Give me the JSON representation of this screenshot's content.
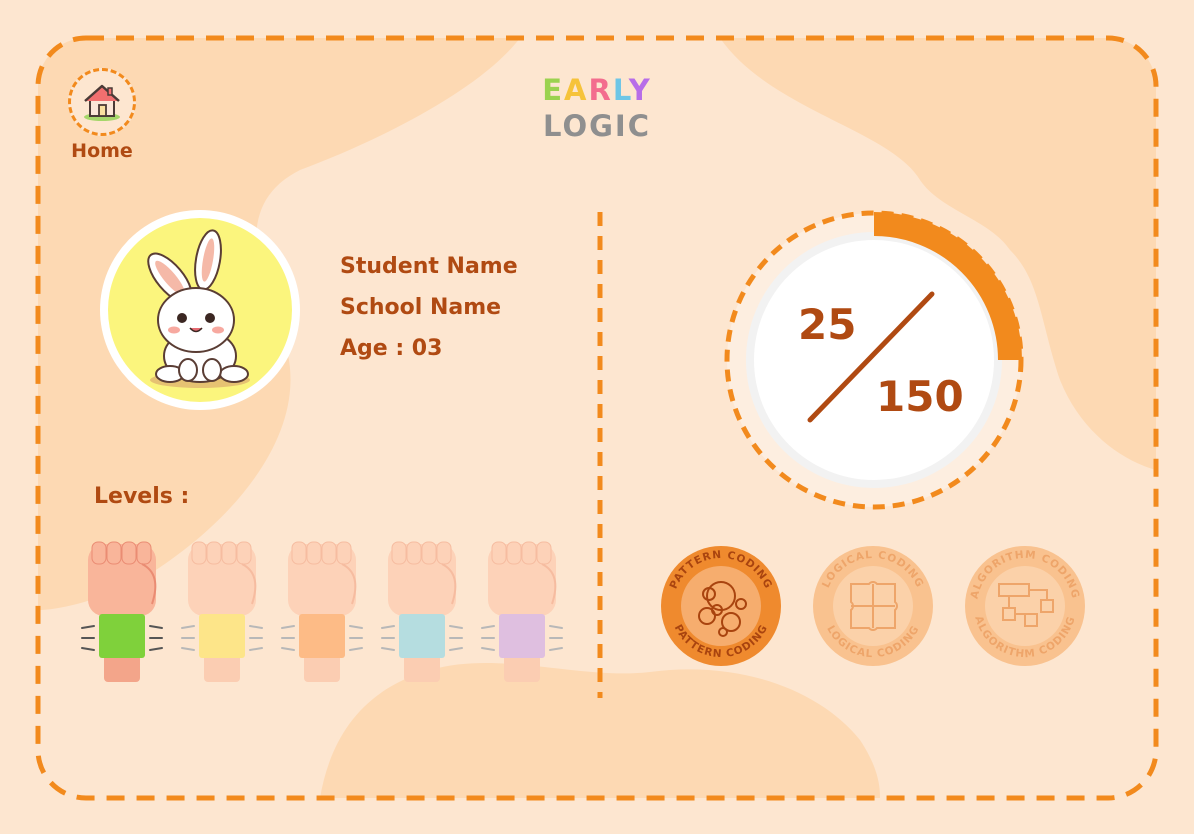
{
  "app": {
    "logo_top": [
      "E",
      "A",
      "R",
      "L",
      "Y"
    ],
    "logo_top_colors": [
      "#9bd24f",
      "#f6c33a",
      "#f36d8e",
      "#6fc6e6",
      "#b76de8"
    ],
    "logo_bottom": "LOGIC"
  },
  "nav": {
    "home_label": "Home",
    "icon": "house-icon"
  },
  "student": {
    "name": "Student Name",
    "school": "School Name",
    "age": "Age : 03",
    "avatar": "rabbit-avatar"
  },
  "levels": {
    "title": "Levels :",
    "items": [
      {
        "band_color": "#7fd13b",
        "hand_color": "#f9b59a",
        "active": true
      },
      {
        "band_color": "#fde589",
        "hand_color": "#fdd2b8",
        "active": false
      },
      {
        "band_color": "#fdbb86",
        "hand_color": "#fdd2b8",
        "active": false
      },
      {
        "band_color": "#b5dde0",
        "hand_color": "#fdd2b8",
        "active": false
      },
      {
        "band_color": "#dfbfe0",
        "hand_color": "#fdd2b8",
        "active": false
      }
    ]
  },
  "score": {
    "current": "25",
    "total": "150",
    "progress_fraction": 0.25
  },
  "badges": [
    {
      "label": "PATTERN CODING",
      "icon": "bubbles-icon",
      "active": true
    },
    {
      "label": "LOGICAL CODING",
      "icon": "puzzle-icon",
      "active": false
    },
    {
      "label": "ALGORITHM CODING",
      "icon": "flowchart-icon",
      "active": false
    }
  ],
  "colors": {
    "accent": "#f28a1d",
    "text": "#b04a12",
    "background": "#fde6d0",
    "blob": "#fdd9b3"
  }
}
